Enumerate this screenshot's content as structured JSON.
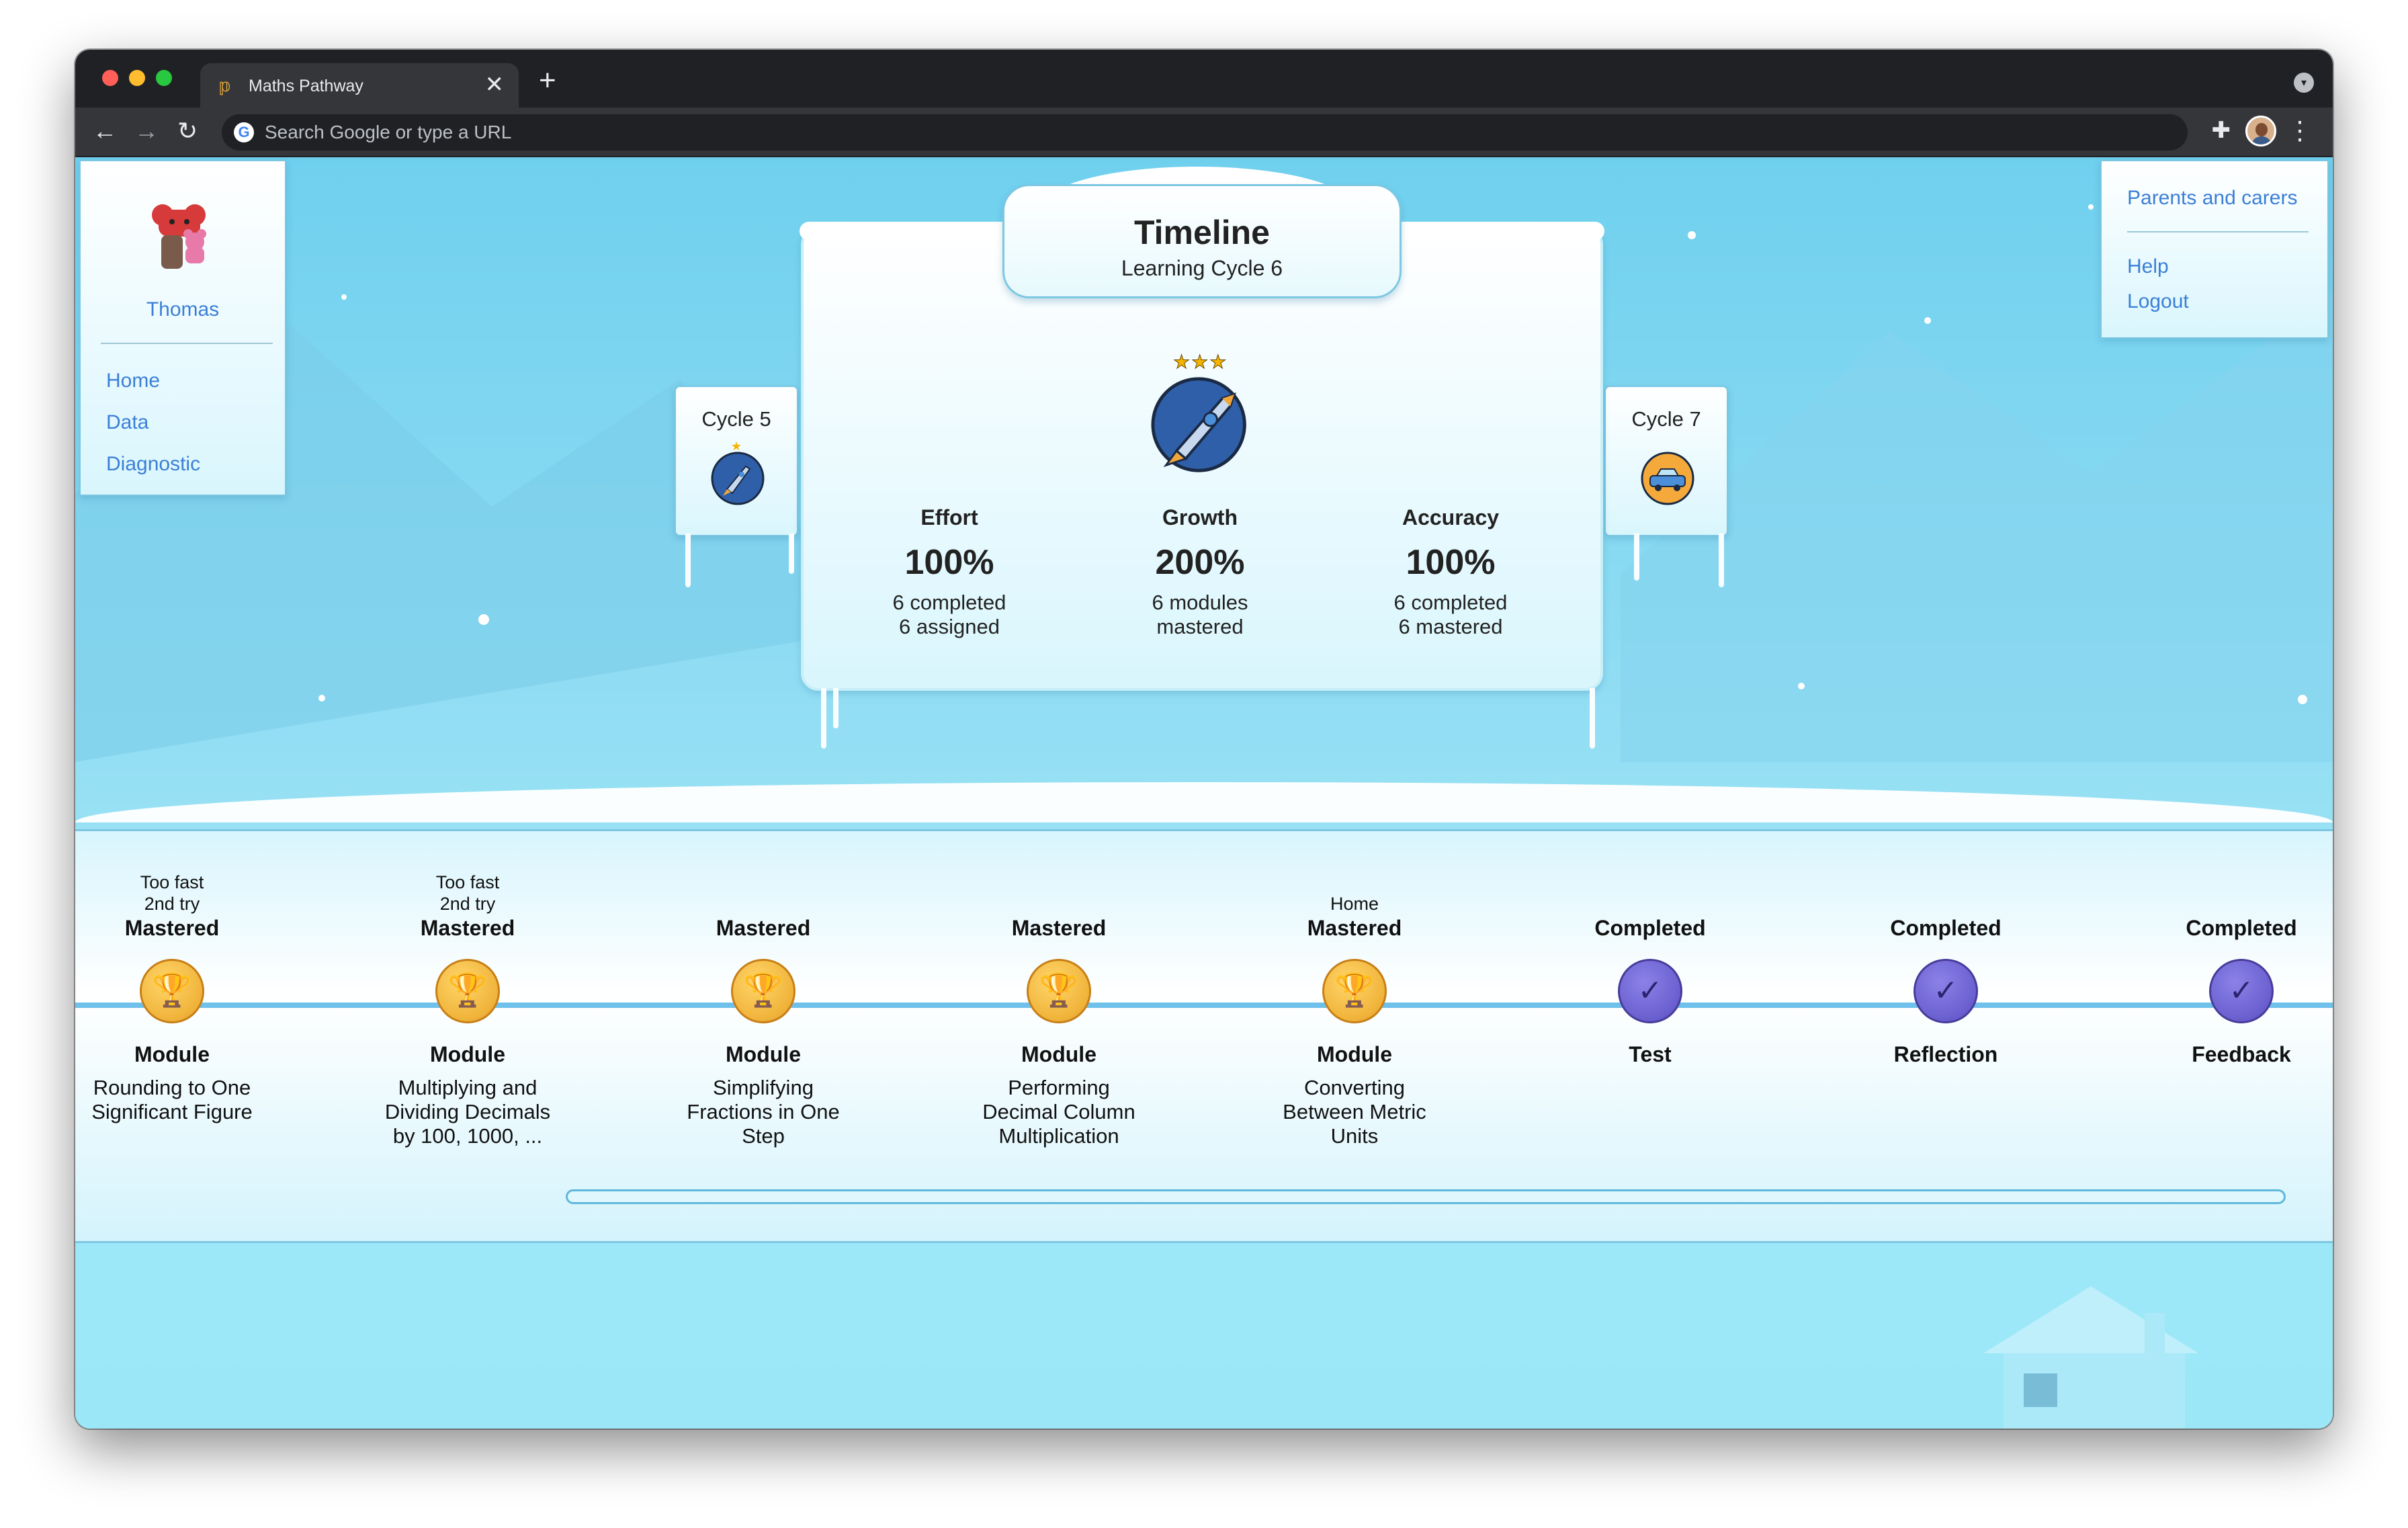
{
  "browser": {
    "tab_title": "Maths Pathway",
    "tab_favicon": "𝕡",
    "new_tab_label": "+",
    "omnibox_placeholder": "Search Google or type a URL",
    "close_glyph": "✕"
  },
  "sidebar": {
    "user_name": "Thomas",
    "items": [
      {
        "label": "Home"
      },
      {
        "label": "Data"
      },
      {
        "label": "Diagnostic"
      }
    ]
  },
  "account_menu": {
    "parents_label": "Parents and carers",
    "help_label": "Help",
    "logout_label": "Logout"
  },
  "timeline": {
    "title": "Timeline",
    "subtitle": "Learning Cycle 6",
    "stars": "★★★",
    "prev_cycle": {
      "label": "Cycle 5",
      "stars": "★"
    },
    "next_cycle": {
      "label": "Cycle 7"
    },
    "stats": [
      {
        "heading": "Effort",
        "value": "100%",
        "line1": "6 completed",
        "line2": "6 assigned"
      },
      {
        "heading": "Growth",
        "value": "200%",
        "line1": "6 modules",
        "line2": "mastered"
      },
      {
        "heading": "Accuracy",
        "value": "100%",
        "line1": "6 completed",
        "line2": "6 mastered"
      }
    ]
  },
  "steps": [
    {
      "note1": "Too fast",
      "note2": "2nd try",
      "status": "Mastered",
      "kind": "Module",
      "name1": "Rounding to One",
      "name2": "Significant Figure",
      "name3": "",
      "medal": "trophy-icon"
    },
    {
      "note1": "Too fast",
      "note2": "2nd try",
      "status": "Mastered",
      "kind": "Module",
      "name1": "Multiplying and",
      "name2": "Dividing Decimals",
      "name3": "by 100, 1000, ...",
      "medal": "trophy-icon"
    },
    {
      "note1": "",
      "note2": "",
      "status": "Mastered",
      "kind": "Module",
      "name1": "Simplifying",
      "name2": "Fractions in One",
      "name3": "Step",
      "medal": "trophy-icon"
    },
    {
      "note1": "",
      "note2": "",
      "status": "Mastered",
      "kind": "Module",
      "name1": "Performing",
      "name2": "Decimal Column",
      "name3": "Multiplication",
      "medal": "trophy-icon"
    },
    {
      "note1": "",
      "note2": "Home",
      "status": "Mastered",
      "kind": "Module",
      "name1": "Converting",
      "name2": "Between Metric",
      "name3": "Units",
      "medal": "trophy-icon"
    },
    {
      "note1": "",
      "note2": "",
      "status": "Completed",
      "kind": "Test",
      "name1": "",
      "name2": "",
      "name3": "",
      "medal": "check-icon"
    },
    {
      "note1": "",
      "note2": "",
      "status": "Completed",
      "kind": "Reflection",
      "name1": "",
      "name2": "",
      "name3": "",
      "medal": "check-icon"
    },
    {
      "note1": "",
      "note2": "",
      "status": "Completed",
      "kind": "Feedback",
      "name1": "",
      "name2": "",
      "name3": "",
      "medal": "check-icon"
    }
  ],
  "glyphs": {
    "trophy": "🏆",
    "check": "✓"
  },
  "colors": {
    "link": "#3b7fd6",
    "gold_medal": "#f0b33a",
    "purple_medal": "#6a5fcf",
    "track": "#6fc0ea"
  }
}
